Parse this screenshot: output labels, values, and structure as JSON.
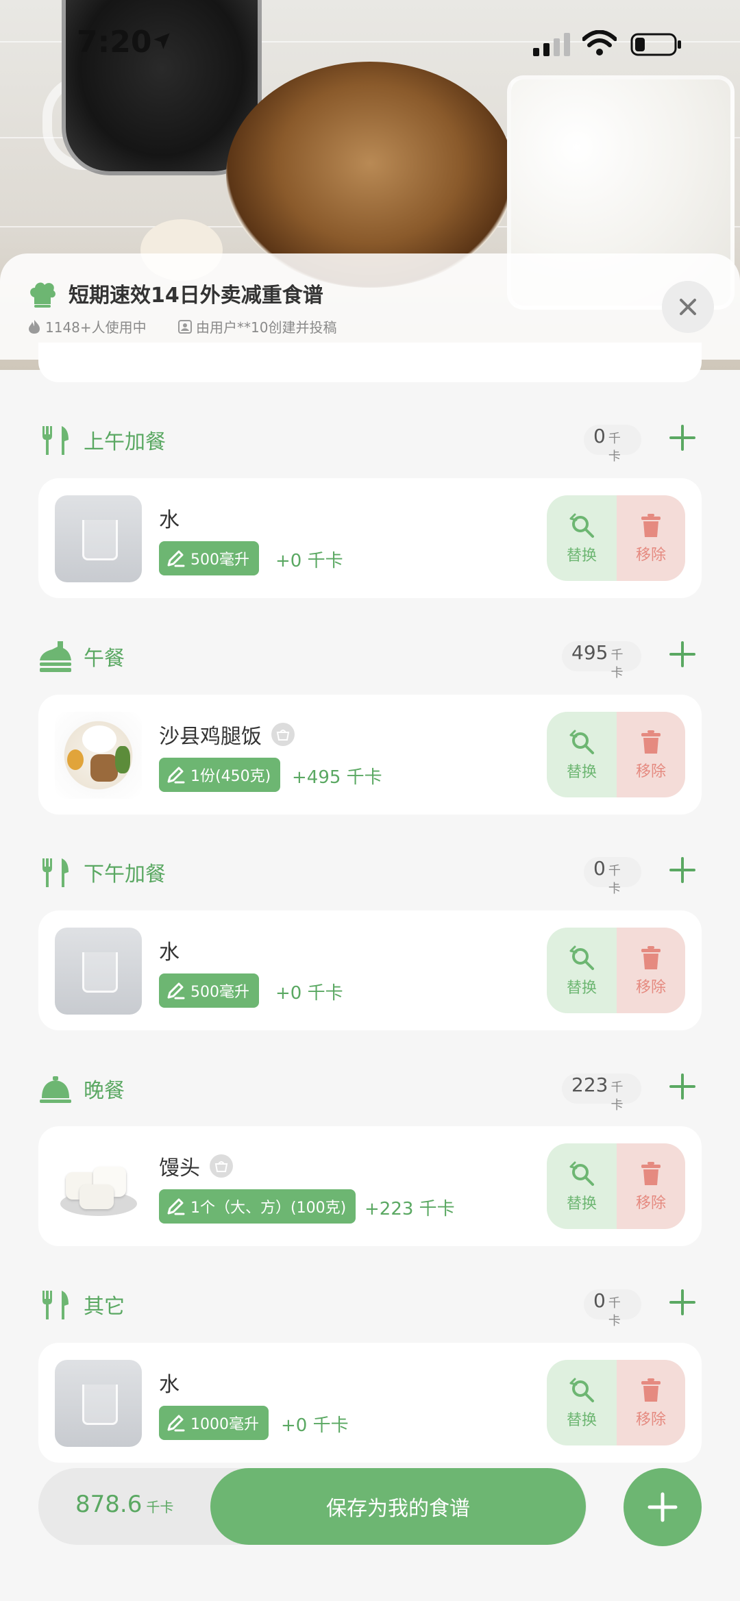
{
  "status_bar": {
    "time": "7:20"
  },
  "header": {
    "title": "短期速效14日外卖减重食谱",
    "users": "1148+人使用中",
    "author": "由用户**10创建并投稿"
  },
  "sections": [
    {
      "title": "上午加餐",
      "kcal": "0",
      "unit": "千卡",
      "item": {
        "name": "水",
        "portion": "500毫升",
        "calories": "+0 千卡",
        "swap": "替换",
        "remove": "移除"
      }
    },
    {
      "title": "午餐",
      "kcal": "495",
      "unit": "千卡",
      "item": {
        "name": "沙县鸡腿饭",
        "portion": "1份(450克)",
        "calories": "+495 千卡",
        "swap": "替换",
        "remove": "移除"
      }
    },
    {
      "title": "下午加餐",
      "kcal": "0",
      "unit": "千卡",
      "item": {
        "name": "水",
        "portion": "500毫升",
        "calories": "+0 千卡",
        "swap": "替换",
        "remove": "移除"
      }
    },
    {
      "title": "晚餐",
      "kcal": "223",
      "unit": "千卡",
      "item": {
        "name": "馒头",
        "portion": "1个（大、方）(100克)",
        "calories": "+223 千卡",
        "swap": "替换",
        "remove": "移除"
      }
    },
    {
      "title": "其它",
      "kcal": "0",
      "unit": "千卡",
      "item": {
        "name": "水",
        "portion": "1000毫升",
        "calories": "+0 千卡",
        "swap": "替换",
        "remove": "移除"
      }
    }
  ],
  "bottom": {
    "total": "878.6",
    "total_unit": "千卡",
    "save_label": "保存为我的食谱"
  },
  "colors": {
    "accent": "#6db672",
    "text_green": "#5aa862",
    "swap_bg": "#dff0df",
    "remove_bg": "#f4dcd8",
    "remove_text": "#e58a80"
  }
}
